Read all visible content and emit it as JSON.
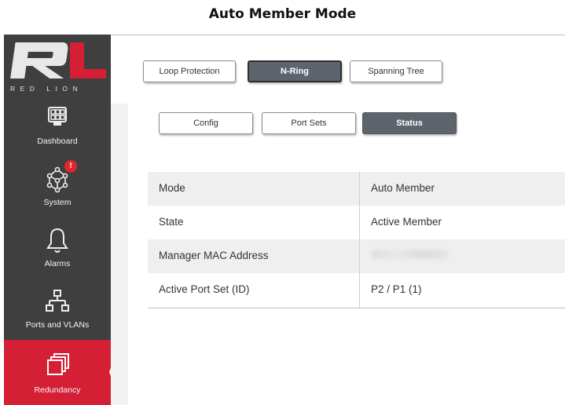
{
  "caption": "Auto Member Mode",
  "brand": {
    "logo_text": "RED LION",
    "accent": "#d51f35",
    "sidebar_bg": "#3f3f3f"
  },
  "sidebar": {
    "items": [
      {
        "label": "Dashboard",
        "icon": "dashboard-icon"
      },
      {
        "label": "System",
        "icon": "system-network-icon",
        "badge": "!"
      },
      {
        "label": "Alarms",
        "icon": "bell-icon"
      },
      {
        "label": "Ports and VLANs",
        "icon": "ports-topology-icon"
      },
      {
        "label": "Redundancy",
        "icon": "redundancy-icon",
        "active": true
      }
    ]
  },
  "top_tabs": {
    "items": [
      "Loop Protection",
      "N-Ring",
      "Spanning Tree"
    ],
    "selected": "N-Ring"
  },
  "sub_tabs": {
    "items": [
      "Config",
      "Port Sets",
      "Status"
    ],
    "selected": "Status"
  },
  "status_table": {
    "rows": [
      {
        "key": "Mode",
        "value": "Auto Member"
      },
      {
        "key": "State",
        "value": "Active Member"
      },
      {
        "key": "Manager MAC Address",
        "value": ""
      },
      {
        "key": "Active Port Set (ID)",
        "value": "P2 / P1 (1)"
      }
    ]
  }
}
